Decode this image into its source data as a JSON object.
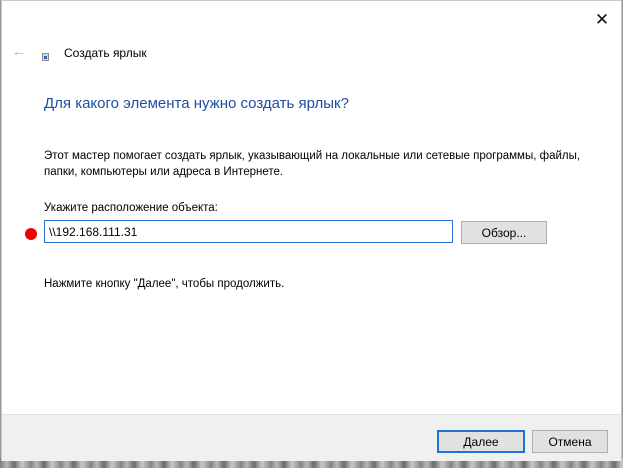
{
  "window": {
    "title": "Создать ярлык",
    "close_icon": "close-icon",
    "back_icon": "back-arrow-icon",
    "app_icon": "shortcut-wizard-icon"
  },
  "main": {
    "heading": "Для какого элемента нужно создать ярлык?",
    "description": "Этот мастер помогает создать ярлык, указывающий на локальные или сетевые программы, файлы, папки, компьютеры или адреса в Интернете.",
    "location_label": "Укажите расположение объекта:",
    "location_value": "\\\\192.168.111.31",
    "browse_label": "Обзор...",
    "hint": "Нажмите кнопку \"Далее\", чтобы продолжить."
  },
  "footer": {
    "next_label": "Далее",
    "cancel_label": "Отмена"
  },
  "colors": {
    "heading": "#1e4ea0",
    "input_focus_border": "#2b73d3",
    "default_button_border": "#1f73d6",
    "marker": "#f00000"
  }
}
